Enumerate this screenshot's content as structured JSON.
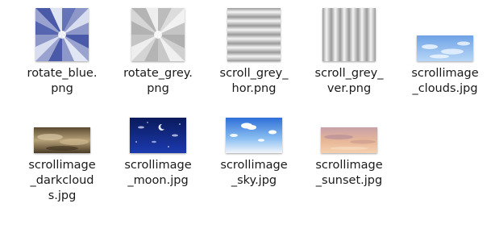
{
  "files": [
    {
      "name": "rotate_blue.\npng",
      "icon": "blue-radial-gradient-thumbnail"
    },
    {
      "name": "rotate_grey.\npng",
      "icon": "grey-radial-gradient-thumbnail"
    },
    {
      "name": "scroll_grey_\nhor.png",
      "icon": "grey-horizontal-stripes-thumbnail"
    },
    {
      "name": "scroll_grey_\nver.png",
      "icon": "grey-vertical-stripes-thumbnail"
    },
    {
      "name": "scrollimage\n_clouds.jpg",
      "icon": "clouds-thumbnail"
    },
    {
      "name": "scrollimage\n_darkcloud\ns.jpg",
      "icon": "dark-clouds-thumbnail"
    },
    {
      "name": "scrollimage\n_moon.jpg",
      "icon": "moon-night-thumbnail"
    },
    {
      "name": "scrollimage\n_sky.jpg",
      "icon": "sky-thumbnail"
    },
    {
      "name": "scrollimage\n_sunset.jpg",
      "icon": "sunset-thumbnail"
    }
  ]
}
